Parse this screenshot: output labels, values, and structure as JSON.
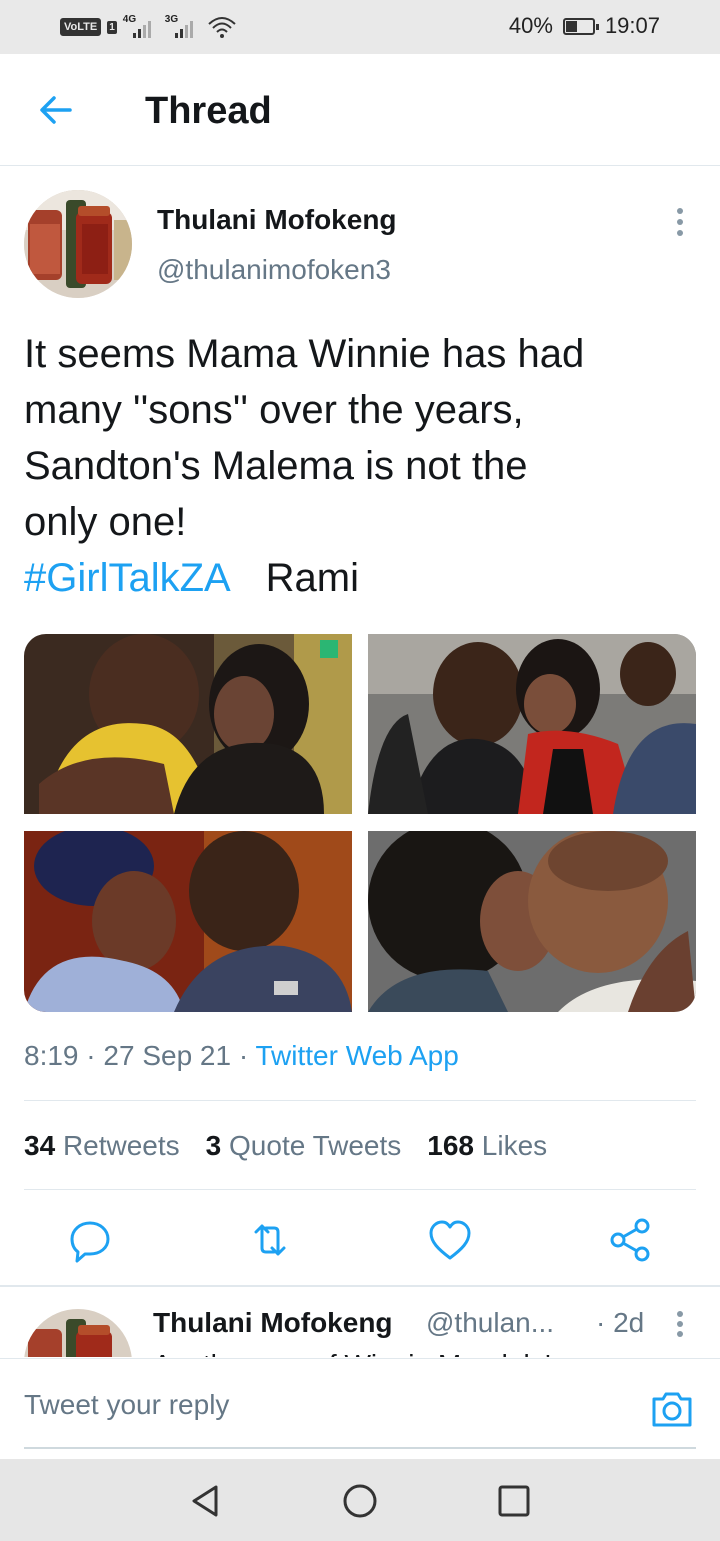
{
  "status_bar": {
    "volte": "VoLTE",
    "sim1": "1",
    "net1": "4G",
    "net2": "3G",
    "battery": "40%",
    "time": "19:07"
  },
  "header": {
    "title": "Thread",
    "back_icon": "arrow-left-icon"
  },
  "tweet": {
    "author_name": "Thulani Mofokeng",
    "author_handle": "@thulanimofoken3",
    "text_lines": [
      "It seems Mama Winnie has had",
      "many ''sons'' over the years,",
      "Sandton's Malema is not the",
      "only one!"
    ],
    "hashtag": "#GirlTalkZA",
    "trailing": "Rami",
    "images": [
      "photo-1",
      "photo-2",
      "photo-3",
      "photo-4"
    ],
    "time": "8:19",
    "date": "27 Sep 21",
    "source": "Twitter Web App",
    "stats": {
      "retweets_count": "34",
      "retweets_label": "Retweets",
      "quotes_count": "3",
      "quotes_label": "Quote Tweets",
      "likes_count": "168",
      "likes_label": "Likes"
    },
    "actions": [
      "reply-icon",
      "retweet-icon",
      "like-icon",
      "share-icon"
    ]
  },
  "reply_preview": {
    "author_name": "Thulani Mofokeng",
    "author_handle": "@thulan...",
    "time": "· 2d",
    "text": "Another one of Winnie Mandela's"
  },
  "composer": {
    "placeholder": "Tweet your reply",
    "icon": "camera-icon"
  },
  "colors": {
    "accent": "#1da1f2",
    "text": "#14171a",
    "secondary": "#657786",
    "divider": "#e1e8ed"
  }
}
